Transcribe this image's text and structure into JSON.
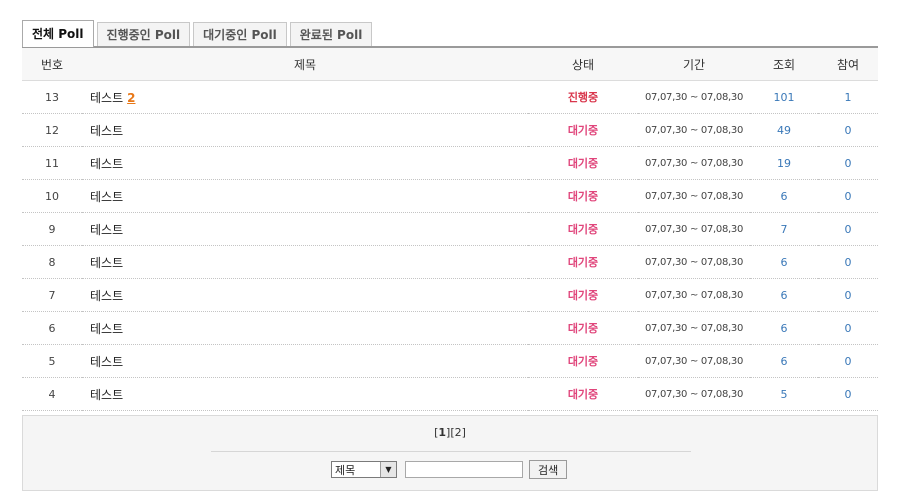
{
  "tabs": [
    {
      "label": "전체 Poll",
      "active": true
    },
    {
      "label": "진행중인 Poll",
      "active": false
    },
    {
      "label": "대기중인 Poll",
      "active": false
    },
    {
      "label": "완료된 Poll",
      "active": false
    }
  ],
  "columns": {
    "num": "번호",
    "title": "제목",
    "status": "상태",
    "period": "기간",
    "views": "조회",
    "join": "참여"
  },
  "rows": [
    {
      "num": "13",
      "title": "테스트",
      "comments": "2",
      "status": "진행중",
      "status_type": "active",
      "period": "07,07,30 ~ 07,08,30",
      "views": "101",
      "join": "1"
    },
    {
      "num": "12",
      "title": "테스트",
      "comments": "",
      "status": "대기중",
      "status_type": "wait",
      "period": "07,07,30 ~ 07,08,30",
      "views": "49",
      "join": "0"
    },
    {
      "num": "11",
      "title": "테스트",
      "comments": "",
      "status": "대기중",
      "status_type": "wait",
      "period": "07,07,30 ~ 07,08,30",
      "views": "19",
      "join": "0"
    },
    {
      "num": "10",
      "title": "테스트",
      "comments": "",
      "status": "대기중",
      "status_type": "wait",
      "period": "07,07,30 ~ 07,08,30",
      "views": "6",
      "join": "0"
    },
    {
      "num": "9",
      "title": "테스트",
      "comments": "",
      "status": "대기중",
      "status_type": "wait",
      "period": "07,07,30 ~ 07,08,30",
      "views": "7",
      "join": "0"
    },
    {
      "num": "8",
      "title": "테스트",
      "comments": "",
      "status": "대기중",
      "status_type": "wait",
      "period": "07,07,30 ~ 07,08,30",
      "views": "6",
      "join": "0"
    },
    {
      "num": "7",
      "title": "테스트",
      "comments": "",
      "status": "대기중",
      "status_type": "wait",
      "period": "07,07,30 ~ 07,08,30",
      "views": "6",
      "join": "0"
    },
    {
      "num": "6",
      "title": "테스트",
      "comments": "",
      "status": "대기중",
      "status_type": "wait",
      "period": "07,07,30 ~ 07,08,30",
      "views": "6",
      "join": "0"
    },
    {
      "num": "5",
      "title": "테스트",
      "comments": "",
      "status": "대기중",
      "status_type": "wait",
      "period": "07,07,30 ~ 07,08,30",
      "views": "6",
      "join": "0"
    },
    {
      "num": "4",
      "title": "테스트",
      "comments": "",
      "status": "대기중",
      "status_type": "wait",
      "period": "07,07,30 ~ 07,08,30",
      "views": "5",
      "join": "0"
    }
  ],
  "pagination": {
    "current": "1",
    "pages": [
      "2"
    ]
  },
  "search": {
    "field_selected": "제목",
    "field_options": [
      "제목"
    ],
    "query": "",
    "button_label": "검색"
  },
  "colors": {
    "status_active": "#d9364c",
    "status_wait": "#e0457b",
    "count_link": "#3a78b8",
    "comment_count": "#e87818"
  },
  "icons": {
    "select_arrow": "chevron-down-icon"
  }
}
